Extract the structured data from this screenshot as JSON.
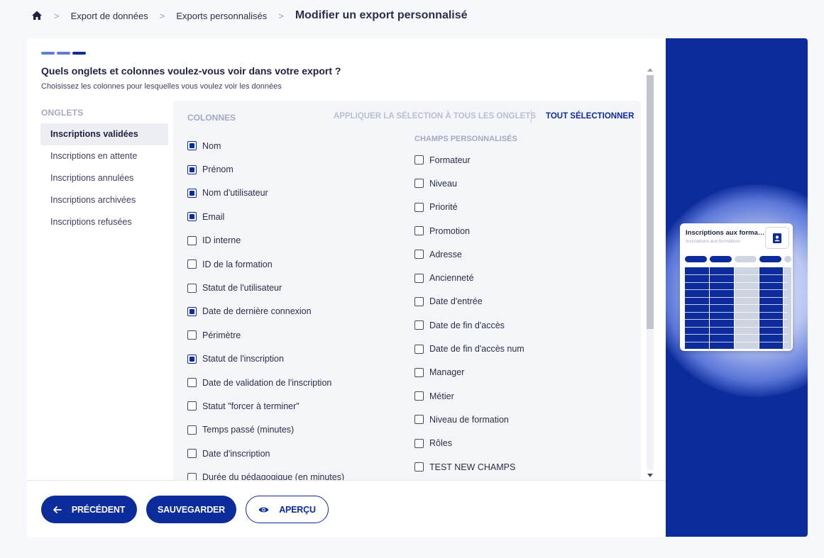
{
  "breadcrumb": {
    "items": [
      "Export de données",
      "Exports personnalisés"
    ],
    "current": "Modifier un export personnalisé",
    "separator": ">"
  },
  "stepper": {
    "total": 3,
    "current": 3
  },
  "page": {
    "question": "Quels onglets et colonnes voulez-vous voir dans votre export ?",
    "subtitle": "Choisissez les colonnes pour lesquelles vous voulez voir les données"
  },
  "tabs": {
    "title": "ONGLETS",
    "items": [
      {
        "label": "Inscriptions validées",
        "active": true
      },
      {
        "label": "Inscriptions en attente",
        "active": false
      },
      {
        "label": "Inscriptions annulées",
        "active": false
      },
      {
        "label": "Inscriptions archivées",
        "active": false
      },
      {
        "label": "Inscriptions refusées",
        "active": false
      }
    ]
  },
  "columns": {
    "title": "COLONNES",
    "apply_all_label": "APPLIQUER LA SÉLECTION À TOUS LES ONGLETS",
    "select_all_label": "TOUT SÉLECTIONNER",
    "standard": [
      {
        "label": "Nom",
        "checked": true
      },
      {
        "label": "Prénom",
        "checked": true
      },
      {
        "label": "Nom d'utilisateur",
        "checked": true
      },
      {
        "label": "Email",
        "checked": true
      },
      {
        "label": "ID interne",
        "checked": false
      },
      {
        "label": "ID de la formation",
        "checked": false
      },
      {
        "label": "Statut de l'utilisateur",
        "checked": false
      },
      {
        "label": "Date de dernière connexion",
        "checked": true
      },
      {
        "label": "Périmètre",
        "checked": false
      },
      {
        "label": "Statut de l'inscription",
        "checked": true
      },
      {
        "label": "Date de validation de l'inscription",
        "checked": false
      },
      {
        "label": "Statut \"forcer à terminer\"",
        "checked": false
      },
      {
        "label": "Temps passé (minutes)",
        "checked": false
      },
      {
        "label": "Date d'inscription",
        "checked": false
      },
      {
        "label": "Durée du pédagogique (en minutes)",
        "checked": false
      }
    ],
    "custom_title": "CHAMPS PERSONNALISÉS",
    "custom": [
      {
        "label": "Formateur",
        "checked": false
      },
      {
        "label": "Niveau",
        "checked": false
      },
      {
        "label": "Priorité",
        "checked": false
      },
      {
        "label": "Promotion",
        "checked": false
      },
      {
        "label": "Adresse",
        "checked": false
      },
      {
        "label": "Ancienneté",
        "checked": false
      },
      {
        "label": "Date d'entrée",
        "checked": false
      },
      {
        "label": "Date de fin d'accès",
        "checked": false
      },
      {
        "label": "Date de fin d'accès num",
        "checked": false
      },
      {
        "label": "Manager",
        "checked": false
      },
      {
        "label": "Métier",
        "checked": false
      },
      {
        "label": "Niveau de formation",
        "checked": false
      },
      {
        "label": "Rôles",
        "checked": false
      },
      {
        "label": "TEST NEW CHAMPS",
        "checked": false
      }
    ]
  },
  "footer": {
    "prev_label": "PRÉCÉDENT",
    "save_label": "SAUVEGARDER",
    "preview_label": "APERÇU"
  },
  "preview_card": {
    "title": "Inscriptions aux formations",
    "subtitle": "Inscriptions aux formations"
  },
  "colors": {
    "accent": "#0c2c9b",
    "step_inactive": "#5f7fd6",
    "tab_active_bg": "#eceef4",
    "panel_bg": "#f4f5f8",
    "muted_text": "#a3aac0"
  },
  "icons": {
    "home": "home-icon",
    "prev": "arrow-left-icon",
    "preview": "eye-icon",
    "contact": "contact-book-icon"
  }
}
